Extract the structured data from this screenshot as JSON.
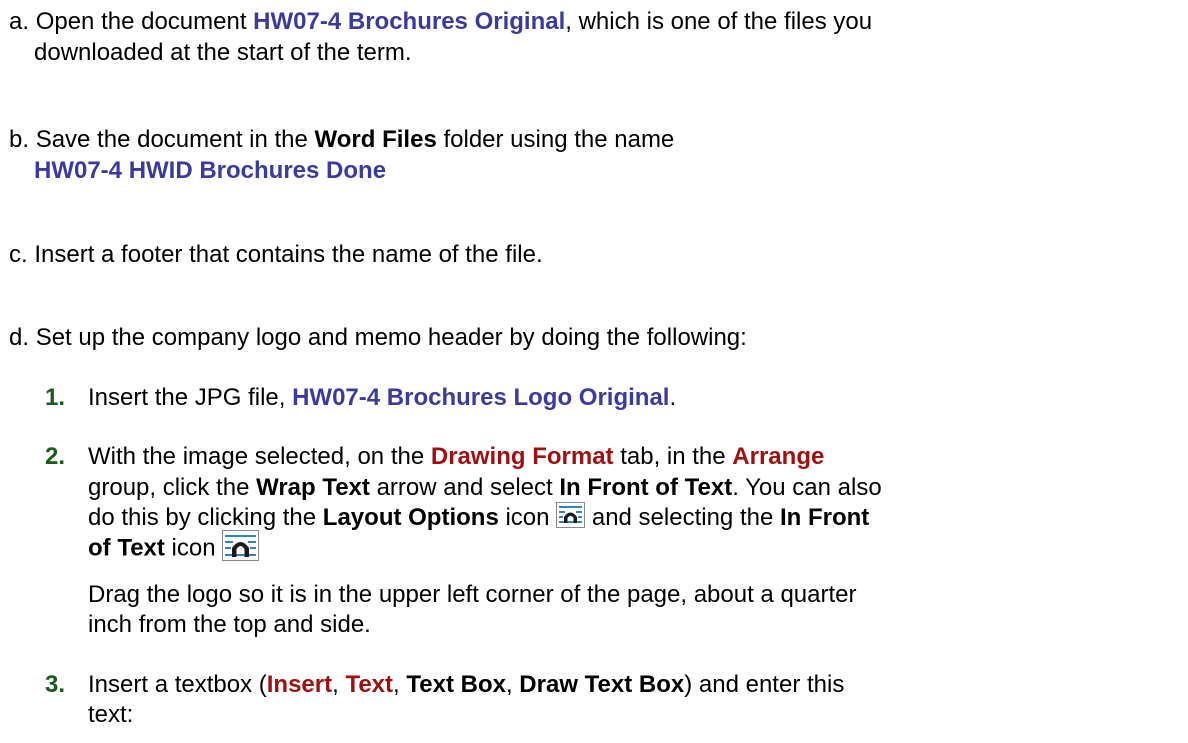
{
  "steps": [
    {
      "letter": "a.",
      "t1": "Open the document ",
      "file": "HW07-4 Brochures Original",
      "t2": ", which is one of the files you",
      "t3": "downloaded at the start of the term."
    },
    {
      "letter": "b.",
      "t1": "Save the document in the ",
      "folder": "Word Files",
      "t2": " folder using the name",
      "file": "HW07-4 HWID Brochures Done"
    },
    {
      "letter": "c.",
      "t1": "Insert a footer that contains the name of the file."
    },
    {
      "letter": "d.",
      "t1": "Set up the company logo and memo header by doing the following:"
    }
  ],
  "substeps": [
    {
      "num": "1.",
      "t1": "Insert the JPG file, ",
      "file": "HW07-4 Brochures Logo Original",
      "t2": "."
    },
    {
      "num": "2.",
      "t1": "With the image selected, on the ",
      "tab": "Drawing Format",
      "t2": " tab, in the ",
      "group": "Arrange",
      "t3": "group, click the ",
      "wrap_text": "Wrap Text",
      "t4": " arrow and select ",
      "in_front": "In Front of Text",
      "t5": ". You can also",
      "t6": "do this by clicking the ",
      "layout_options": "Layout Options",
      "t7": " icon ",
      "t8": " and selecting the ",
      "in_front_a": "In Front",
      "in_front_b": "of Text",
      "t9": " icon",
      "p2_l1": "Drag the logo so it is in the upper left corner of the page, about a quarter",
      "p2_l2": "inch from the top and side."
    },
    {
      "num": "3.",
      "t1": "Insert a textbox (",
      "insert": "Insert",
      "sep1": ", ",
      "text": "Text",
      "sep2": ", ",
      "text_box": "Text Box",
      "sep3": ", ",
      "draw_text_box": "Draw Text Box",
      "t2": ") and enter this",
      "t3": "text:"
    }
  ],
  "colors": {
    "file": "#3a3aa0",
    "ribbon": "#a01010",
    "number": "#1a5c1a",
    "icon": "#2e86c1"
  },
  "icons": [
    "layout-options-icon",
    "in-front-of-text-icon"
  ]
}
